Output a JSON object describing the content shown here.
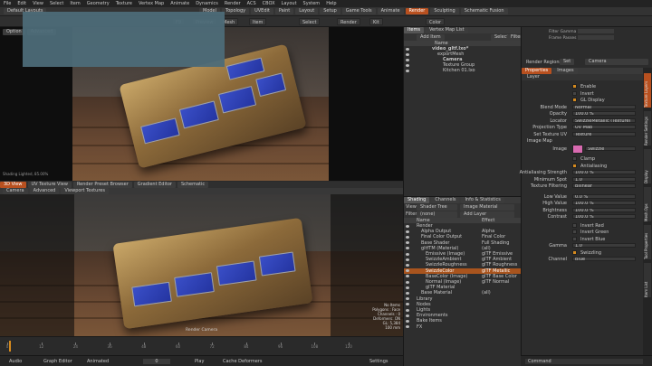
{
  "menu": [
    "File",
    "Edit",
    "View",
    "Select",
    "Item",
    "Geometry",
    "Texture",
    "Vertex Map",
    "Animate",
    "Dynamics",
    "Render",
    "ACS",
    "CBOX",
    "Layout",
    "System",
    "Help"
  ],
  "layout_dropdown": "Default Layouts",
  "tabs": [
    "Model",
    "Topology",
    "UVEdit",
    "Paint",
    "Layout",
    "Setup",
    "Game Tools",
    "Animate",
    "Render",
    "Sculpting",
    "Schematic Fusion"
  ],
  "active_tab": "Render",
  "toolbar2_buttons": [
    "F9",
    "Preview",
    "Mesh",
    "Item",
    "Select",
    "Render",
    "Kit",
    "Color"
  ],
  "upper_viewport": {
    "header": [
      "Option",
      "Advanced"
    ],
    "caption": "Shading Lighted, 85.00%"
  },
  "lower_viewport": {
    "tabs": [
      "3D View",
      "UV Texture View",
      "Render Preset Browser",
      "Gradient Editor",
      "Schematic"
    ],
    "subtabs": [
      "Camera",
      "Advanced",
      "Viewport Textures"
    ],
    "camera_label": "Render Camera",
    "info": [
      "No Items",
      "Polygons : Face",
      "Channels : 0",
      "Deformers: ON",
      "GL: 5,384",
      "100 mm"
    ]
  },
  "items_panel": {
    "tabs": [
      "Items",
      "Vertex Map List"
    ],
    "add_item": "Add Item",
    "buttons": [
      "Select",
      "Filter"
    ],
    "header": "Name",
    "rows": [
      {
        "label": "video_gltf.lxo*",
        "indent": 1,
        "bold": true
      },
      {
        "label": "exportMesh",
        "indent": 2
      },
      {
        "label": "Camera",
        "indent": 3,
        "bold": true
      },
      {
        "label": "Texture Group",
        "indent": 3
      },
      {
        "label": "Kitchen 01.lxo",
        "indent": 3
      }
    ]
  },
  "shader_panel": {
    "tabs": [
      "Shading",
      "Channels",
      "Info & Statistics"
    ],
    "view_label": "View",
    "view_value": "Shader Tree",
    "image_material": "Image Material",
    "filter_label": "Filter",
    "filter_value": "(none)",
    "add_layer": "Add Layer",
    "columns": [
      "Name",
      "Effect"
    ],
    "rows": [
      {
        "name": "Render",
        "effect": "",
        "indent": 1
      },
      {
        "name": "Alpha Output",
        "effect": "Alpha",
        "indent": 2
      },
      {
        "name": "Final Color Output",
        "effect": "Final Color",
        "indent": 2
      },
      {
        "name": "Base Shader",
        "effect": "Full Shading",
        "indent": 2
      },
      {
        "name": "gltfTM (Material)",
        "effect": "(all)",
        "indent": 2
      },
      {
        "name": "Emissive (Image)",
        "effect": "glTF Emissive",
        "indent": 3
      },
      {
        "name": "SwizzleAmbient",
        "effect": "glTF Ambient",
        "indent": 3
      },
      {
        "name": "SwizzleRoughness",
        "effect": "glTF Roughness",
        "indent": 3
      },
      {
        "name": "SwizzleColor",
        "effect": "glTF Metallic",
        "indent": 3,
        "selected": true
      },
      {
        "name": "BaseColor (Image)",
        "effect": "glTF Base Color",
        "indent": 3
      },
      {
        "name": "Normal (Image)",
        "effect": "glTF Normal",
        "indent": 3
      },
      {
        "name": "glTF Material",
        "effect": "",
        "indent": 3
      },
      {
        "name": "Base Material",
        "effect": "(all)",
        "indent": 2
      },
      {
        "name": "Library",
        "effect": "",
        "indent": 1
      },
      {
        "name": "Nodes",
        "effect": "",
        "indent": 1
      },
      {
        "name": "Lights",
        "effect": "",
        "indent": 1
      },
      {
        "name": "Environments",
        "effect": "",
        "indent": 1
      },
      {
        "name": "Bake Items",
        "effect": "",
        "indent": 1
      },
      {
        "name": "FX",
        "effect": "",
        "indent": 1
      }
    ]
  },
  "right_top": {
    "rows": [
      {
        "label": "Filter Gamma",
        "value": "..."
      },
      {
        "label": "Frame Passes",
        "value": "..."
      },
      {
        "label": "Render Region",
        "value": ""
      }
    ],
    "render_regions": "Render Regions",
    "set": "Set",
    "camera_label": "Camera"
  },
  "properties": {
    "tabs": [
      "Properties",
      "Images"
    ],
    "section": "Layer",
    "sidebar_tabs": [
      "Texture Layers",
      "Render Settings",
      "Display",
      "Mesh Ops",
      "Tool Properties",
      "Item List"
    ],
    "checks": [
      {
        "label": "Enable",
        "on": true
      },
      {
        "label": "Invert",
        "on": false
      },
      {
        "label": "GL Display",
        "on": true
      }
    ],
    "fields": [
      {
        "label": "Blend Mode",
        "value": "Normal"
      },
      {
        "label": "Opacity",
        "value": "100.0 %"
      },
      {
        "label": "Locator",
        "value": "SwizzleMetallic (Texture)"
      },
      {
        "label": "Projection Type",
        "value": "UV Map"
      },
      {
        "label": "Set Texture UV",
        "value": "Texture"
      }
    ],
    "image_map": "Image Map",
    "image_label": "Image",
    "image_value": "Swizzle",
    "image_checks": [
      {
        "label": "Clamp",
        "on": false
      },
      {
        "label": "Antialiasing",
        "on": true
      }
    ],
    "image_fields": [
      {
        "label": "Antialiasing Strength",
        "value": "100.0 %"
      },
      {
        "label": "Minimum Spot",
        "value": "1.0"
      },
      {
        "label": "Texture Filtering",
        "value": "Bilinear"
      },
      {
        "label": "Low Value",
        "value": "0.0 %"
      },
      {
        "label": "High Value",
        "value": "100.0 %"
      },
      {
        "label": "Brightness",
        "value": "100.0 %"
      },
      {
        "label": "Contrast",
        "value": "100.0 %"
      }
    ],
    "swizzle_checks": [
      {
        "label": "Invert Red",
        "on": false
      },
      {
        "label": "Invert Green",
        "on": false
      },
      {
        "label": "Invert Blue",
        "on": false
      }
    ],
    "gamma_label": "Gamma",
    "gamma_value": "1.0",
    "swizzling": "Swizzling",
    "channel_label": "Channel",
    "channel_value": "Blue"
  },
  "timeline": {
    "ticks": [
      0,
      12,
      24,
      36,
      48,
      60,
      72,
      84,
      96,
      108,
      120
    ],
    "current": 0
  },
  "statusbar": {
    "items": [
      "Audio",
      "Graph Editor",
      "Animated",
      "Play",
      "Cache Deformers",
      "Settings"
    ],
    "frame": "0",
    "command": "Command"
  },
  "colors": {
    "accent": "#d58a1e",
    "selection": "#a8541e",
    "overlay": "#4d6b78"
  }
}
